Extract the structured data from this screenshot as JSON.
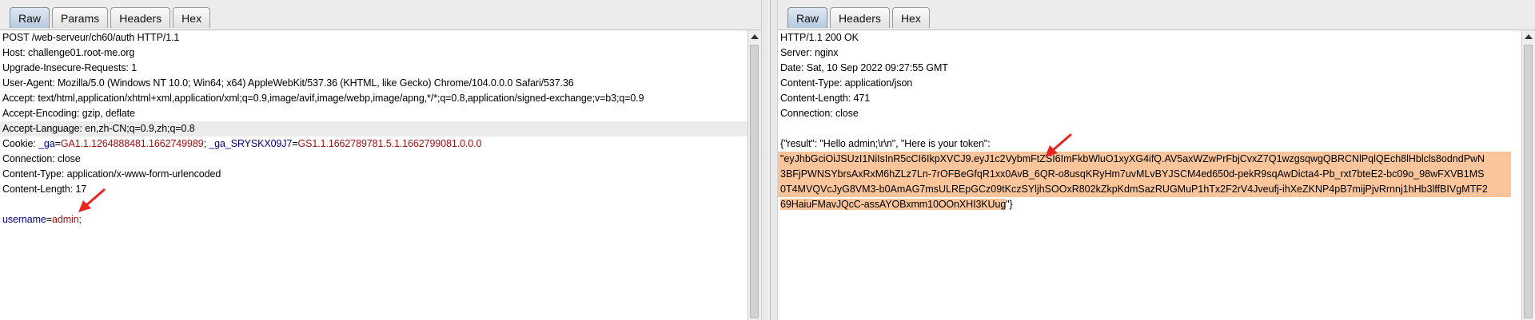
{
  "request": {
    "tabs": [
      "Raw",
      "Params",
      "Headers",
      "Hex"
    ],
    "active_tab": "Raw",
    "lines": [
      "POST /web-serveur/ch60/auth HTTP/1.1",
      "Host: challenge01.root-me.org",
      "Upgrade-Insecure-Requests: 1",
      "User-Agent: Mozilla/5.0 (Windows NT 10.0; Win64; x64) AppleWebKit/537.36 (KHTML, like Gecko) Chrome/104.0.0.0 Safari/537.36",
      "Accept: text/html,application/xhtml+xml,application/xml;q=0.9,image/avif,image/webp,image/apng,*/*;q=0.8,application/signed-exchange;v=b3;q=0.9",
      "Accept-Encoding: gzip, deflate",
      "Accept-Language: en,zh-CN;q=0.9,zh;q=0.8"
    ],
    "cookie": {
      "prefix": "Cookie: ",
      "k1": "_ga",
      "v1": "GA1.1.1264888481.1662749989",
      "k2": "_ga_SRYSKX09J7",
      "v2": "GS1.1.1662789781.5.1.1662799081.0.0.0"
    },
    "lines_after": [
      "Connection: close",
      "Content-Type: application/x-www-form-urlencoded",
      "Content-Length: 17"
    ],
    "body": {
      "key": "username",
      "value": "admin;"
    }
  },
  "response": {
    "tabs": [
      "Raw",
      "Headers",
      "Hex"
    ],
    "active_tab": "Raw",
    "lines": [
      "HTTP/1.1 200 OK",
      "Server: nginx",
      "Date: Sat, 10 Sep 2022 09:27:55 GMT",
      "Content-Type: application/json",
      "Content-Length: 471",
      "Connection: close"
    ],
    "json_prefix": "{\"result\": \"Hello admin;\\r\\n\", \"Here is your token\":",
    "token_lines": [
      "\"eyJhbGciOiJSUzI1NiIsInR5cCI6IkpXVCJ9.eyJ1c2VybmFtZSI6ImFkbWluO1xyXG4ifQ.AV5axWZwPrFbjCvxZ7Q1wzgsqwgQBRCNlPqlQEch8lHblcls8odndPwN",
      "3BFjPWNSYbrsAxRxM6hZLz7Ln-7rOFBeGfqR1xx0AvB_6QR-o8usqKRyHm7uvMLvBYJSCM4ed650d-pekR9sqAwDicta4-Pb_rxt7bteE2-bc09o_98wFXVB1MS",
      "0T4MVQVcJyG8VM3-b0AmAG7msULREpGCz09tKczSYljhSOOxR802kZkpKdmSazRUGMuP1hTx2F2rV4Jveufj-ihXeZKNP4pB7mijPjvRrnnj1hHb3lffBIVgMTF2",
      "69HaiuFMavJQcC-assAYOBxmm10OOnXHI3KUug"
    ],
    "token_suffix": "\"}"
  },
  "colors": {
    "token_highlight": "#fac59b",
    "cookie_key": "#000080",
    "cookie_value": "#a01010",
    "arrow": "#e8251f",
    "active_tab": "#b6c9dd"
  }
}
